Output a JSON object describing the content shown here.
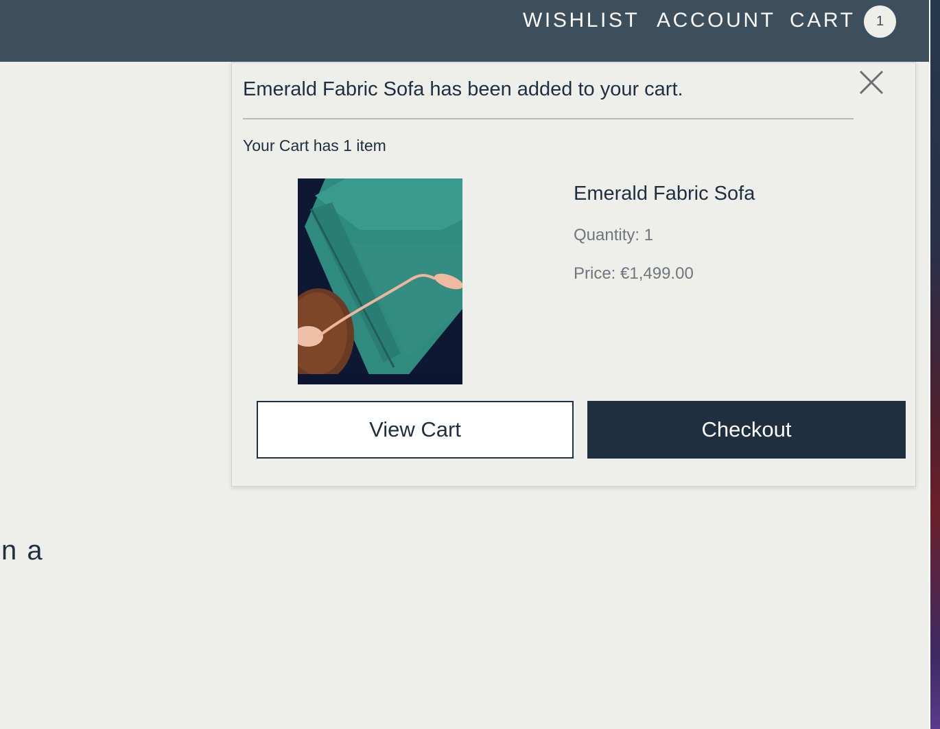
{
  "nav": {
    "wishlist": "WISHLIST",
    "account": "ACCOUNT",
    "cart": "CART",
    "cart_badge": "1"
  },
  "background": {
    "partial_text": "n a"
  },
  "popup": {
    "message": "Emerald Fabric Sofa has been added to your cart.",
    "close_icon": "close-icon",
    "cart_count": "Your Cart has 1 item",
    "product": {
      "name": "Emerald Fabric Sofa",
      "quantity": "Quantity: 1",
      "price": "Price: €1,499.00"
    },
    "view_cart_label": "View Cart",
    "checkout_label": "Checkout"
  },
  "colors": {
    "topbar": "#3d4f5c",
    "accent_dark": "#1f2f40",
    "page_bg": "#eeeeea",
    "muted_text": "#6f767d"
  }
}
